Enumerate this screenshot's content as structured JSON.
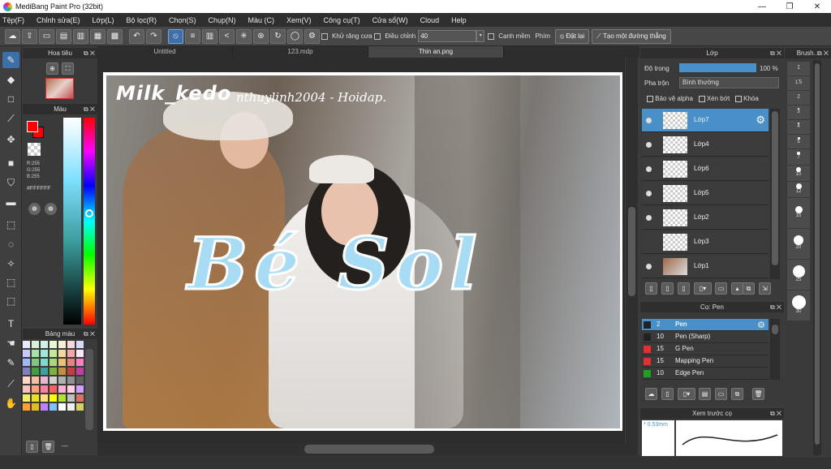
{
  "window": {
    "title": "MediBang Paint Pro (32bit)",
    "min": "—",
    "max": "❐",
    "close": "✕"
  },
  "menu": [
    "Tệp(F)",
    "Chỉnh sửa(E)",
    "Lớp(L)",
    "Bộ lọc(R)",
    "Chọn(S)",
    "Chụp(N)",
    "Màu (C)",
    "Xem(V)",
    "Công cụ(T)",
    "Cửa sổ(W)",
    "Cloud",
    "Help"
  ],
  "toolbar": {
    "antialias": "Khử răng cưa",
    "adjust": "Điều chỉnh",
    "adjust_value": "40",
    "edge": "Cạnh mềm",
    "keys": "Phím",
    "reset": "Đặt lại",
    "straight": "Tạo một đường thẳng"
  },
  "navigator": {
    "title": "Hoa tiêu"
  },
  "color": {
    "title": "Màu",
    "r": "R:255",
    "g": "G:255",
    "b": "B:255",
    "hex": "#FFFFFF",
    "fg": "#ff0000",
    "bg": "#ff0000"
  },
  "palette": {
    "title": "Bảng màu",
    "footer": "---",
    "colors": [
      "#e8e8ff",
      "#d8f0d8",
      "#d0f0e8",
      "#e8f8d0",
      "#f8f0d0",
      "#f8d8d8",
      "#d8d8f8",
      "#c8c8ff",
      "#a8e0a8",
      "#a0e8d8",
      "#c8e8a0",
      "#f0d8a0",
      "#f0a8a8",
      "#f8e8f8",
      "#a0b8ff",
      "#80c880",
      "#80d8c8",
      "#a8d878",
      "#e8c070",
      "#e88080",
      "#ff80c0",
      "#8080c0",
      "#40a040",
      "#40a0a0",
      "#80b040",
      "#c09040",
      "#c04040",
      "#c040a0",
      "#ffd8c8",
      "#f0c0a0",
      "#e8b8d0",
      "#d0d0d0",
      "#b0b0b0",
      "#909090",
      "#606060",
      "#ffc0c0",
      "#ffa080",
      "#ff80a0",
      "#ff6060",
      "#ffb0d0",
      "#ffd0e0",
      "#d0a0ff",
      "#f0f060",
      "#e8e020",
      "#ffe080",
      "#ffff00",
      "#b0e030",
      "#c0c0c0",
      "#e07060",
      "#ffa030",
      "#e0c020",
      "#c080ff",
      "#80c0ff",
      "#ffffff",
      "#f0f0f0",
      "#d8d060"
    ]
  },
  "tabs": [
    "Untitled",
    "123.mdp",
    "Thin an.png"
  ],
  "canvas": {
    "watermark": "Milk_kedo",
    "watermark2": "nthuylinh2004 - Hoidap.",
    "title_text": "Bé Sol"
  },
  "layers": {
    "title": "Lớp",
    "opacity_label": "Độ trong",
    "opacity_value": "100 %",
    "opacity": 1.0,
    "blend_label": "Pha trộn",
    "blend_value": "Bình thường",
    "protect_alpha": "Bảo vệ alpha",
    "clip": "Xén bớt",
    "lock": "Khóa",
    "items": [
      {
        "name": "Lớp7",
        "selected": true
      },
      {
        "name": "Lớp4"
      },
      {
        "name": "Lớp6"
      },
      {
        "name": "Lớp5"
      },
      {
        "name": "Lớp2"
      },
      {
        "name": "Lớp3"
      },
      {
        "name": "Lớp1"
      }
    ]
  },
  "brush": {
    "title": "Cọ: Pen",
    "items": [
      {
        "size": "2",
        "name": "Pen",
        "color": "#222222",
        "selected": true
      },
      {
        "size": "10",
        "name": "Pen (Sharp)",
        "color": "#222222"
      },
      {
        "size": "15",
        "name": "G Pen",
        "color": "#e03030"
      },
      {
        "size": "15",
        "name": "Mapping Pen",
        "color": "#e03030"
      },
      {
        "size": "10",
        "name": "Edge Pen",
        "color": "#20a020"
      }
    ]
  },
  "preview": {
    "title": "Xem trước cọ",
    "size": "* 0.53mm"
  },
  "brushsizes": {
    "title": "Brush...",
    "values": [
      "1",
      "1.5",
      "2",
      "3",
      "4",
      "5",
      "7",
      "10",
      "12",
      "15",
      "20",
      "25",
      "30"
    ]
  }
}
